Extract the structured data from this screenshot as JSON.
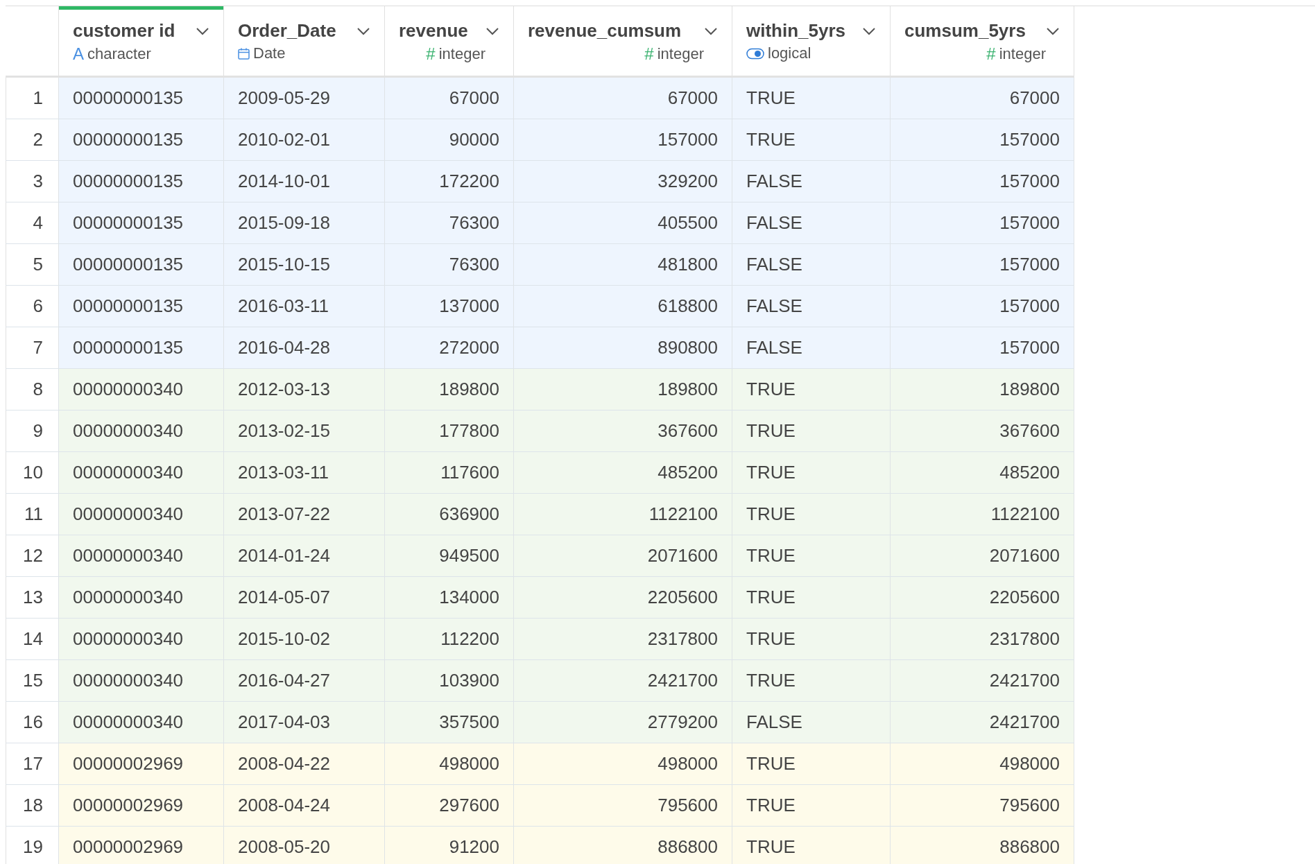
{
  "table": {
    "columns": [
      {
        "name": "customer id",
        "type": "character",
        "kind": "text",
        "type_glyph": "A",
        "selected": true
      },
      {
        "name": "Order_Date",
        "type": "Date",
        "kind": "date",
        "selected": false
      },
      {
        "name": "revenue",
        "type": "integer",
        "kind": "number",
        "type_glyph": "#",
        "selected": false
      },
      {
        "name": "revenue_cumsum",
        "type": "integer",
        "kind": "number",
        "type_glyph": "#",
        "selected": false
      },
      {
        "name": "within_5yrs",
        "type": "logical",
        "kind": "flag",
        "selected": false
      },
      {
        "name": "cumsum_5yrs",
        "type": "integer",
        "kind": "number",
        "type_glyph": "#",
        "selected": false
      }
    ],
    "rows": [
      {
        "number": "1",
        "color": "#eef5fe",
        "cells": [
          "00000000135",
          "2009-05-29",
          "67000",
          "67000",
          "TRUE",
          "67000"
        ]
      },
      {
        "number": "2",
        "color": "#eef5fe",
        "cells": [
          "00000000135",
          "2010-02-01",
          "90000",
          "157000",
          "TRUE",
          "157000"
        ]
      },
      {
        "number": "3",
        "color": "#eef5fe",
        "cells": [
          "00000000135",
          "2014-10-01",
          "172200",
          "329200",
          "FALSE",
          "157000"
        ]
      },
      {
        "number": "4",
        "color": "#eef5fe",
        "cells": [
          "00000000135",
          "2015-09-18",
          "76300",
          "405500",
          "FALSE",
          "157000"
        ]
      },
      {
        "number": "5",
        "color": "#eef5fe",
        "cells": [
          "00000000135",
          "2015-10-15",
          "76300",
          "481800",
          "FALSE",
          "157000"
        ]
      },
      {
        "number": "6",
        "color": "#eef5fe",
        "cells": [
          "00000000135",
          "2016-03-11",
          "137000",
          "618800",
          "FALSE",
          "157000"
        ]
      },
      {
        "number": "7",
        "color": "#eef5fe",
        "cells": [
          "00000000135",
          "2016-04-28",
          "272000",
          "890800",
          "FALSE",
          "157000"
        ]
      },
      {
        "number": "8",
        "color": "#f1f8ee",
        "cells": [
          "00000000340",
          "2012-03-13",
          "189800",
          "189800",
          "TRUE",
          "189800"
        ]
      },
      {
        "number": "9",
        "color": "#f1f8ee",
        "cells": [
          "00000000340",
          "2013-02-15",
          "177800",
          "367600",
          "TRUE",
          "367600"
        ]
      },
      {
        "number": "10",
        "color": "#f1f8ee",
        "cells": [
          "00000000340",
          "2013-03-11",
          "117600",
          "485200",
          "TRUE",
          "485200"
        ]
      },
      {
        "number": "11",
        "color": "#f1f8ee",
        "cells": [
          "00000000340",
          "2013-07-22",
          "636900",
          "1122100",
          "TRUE",
          "1122100"
        ]
      },
      {
        "number": "12",
        "color": "#f1f8ee",
        "cells": [
          "00000000340",
          "2014-01-24",
          "949500",
          "2071600",
          "TRUE",
          "2071600"
        ]
      },
      {
        "number": "13",
        "color": "#f1f8ee",
        "cells": [
          "00000000340",
          "2014-05-07",
          "134000",
          "2205600",
          "TRUE",
          "2205600"
        ]
      },
      {
        "number": "14",
        "color": "#f1f8ee",
        "cells": [
          "00000000340",
          "2015-10-02",
          "112200",
          "2317800",
          "TRUE",
          "2317800"
        ]
      },
      {
        "number": "15",
        "color": "#f1f8ee",
        "cells": [
          "00000000340",
          "2016-04-27",
          "103900",
          "2421700",
          "TRUE",
          "2421700"
        ]
      },
      {
        "number": "16",
        "color": "#f1f8ee",
        "cells": [
          "00000000340",
          "2017-04-03",
          "357500",
          "2779200",
          "FALSE",
          "2421700"
        ]
      },
      {
        "number": "17",
        "color": "#fefbea",
        "cells": [
          "00000002969",
          "2008-04-22",
          "498000",
          "498000",
          "TRUE",
          "498000"
        ]
      },
      {
        "number": "18",
        "color": "#fefbea",
        "cells": [
          "00000002969",
          "2008-04-24",
          "297600",
          "795600",
          "TRUE",
          "795600"
        ]
      },
      {
        "number": "19",
        "color": "#fefbea",
        "cells": [
          "00000002969",
          "2008-05-20",
          "91200",
          "886800",
          "TRUE",
          "886800"
        ]
      }
    ]
  }
}
